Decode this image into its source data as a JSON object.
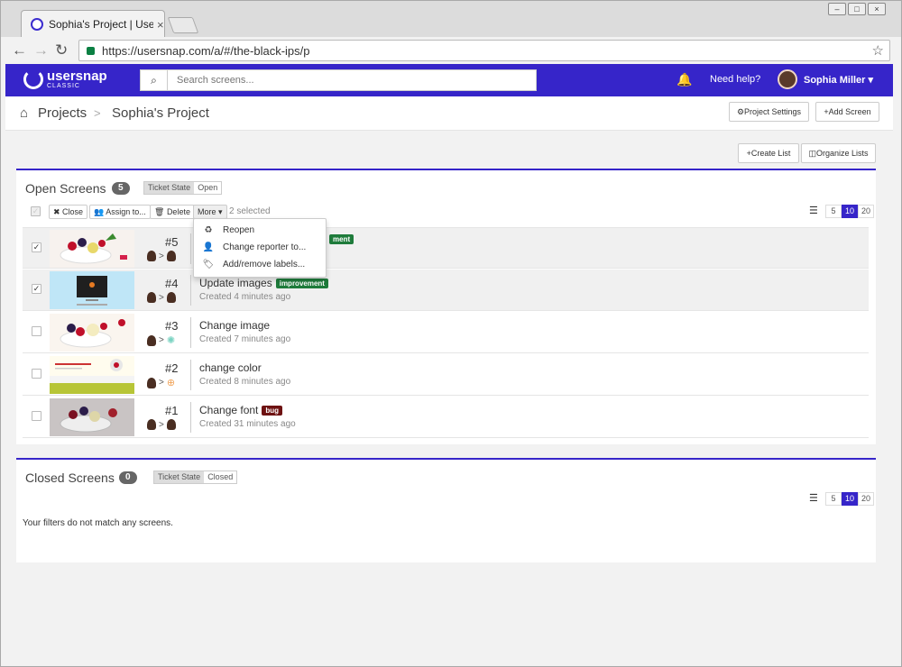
{
  "browser": {
    "tab_title": "Sophia's Project | Usersnap",
    "url": "https://usersnap.com/a/#/the-black-ips/p"
  },
  "topbar": {
    "logo": "usersnap",
    "logo_sub": "CLASSIC",
    "search_placeholder": "Search screens...",
    "help": "Need help?",
    "user": "Sophia Miller"
  },
  "breadcrumb": {
    "projects": "Projects",
    "separator": ">",
    "project": "Sophia's Project"
  },
  "buttons": {
    "project_settings": "Project Settings",
    "add_screen": "Add Screen",
    "create_list": "Create List",
    "organize_lists": "Organize Lists"
  },
  "open_panel": {
    "title": "Open Screens",
    "count": "5",
    "filter_key": "Ticket State",
    "filter_value": "Open",
    "actions": {
      "close": "Close",
      "assign": "Assign to...",
      "delete": "Delete",
      "more": "More",
      "selected": "2 selected"
    },
    "pager": [
      "5",
      "10",
      "20"
    ],
    "dropdown": [
      "Reopen",
      "Change reporter to...",
      "Add/remove labels..."
    ],
    "rows": [
      {
        "num": "#5",
        "title": "",
        "label": "improvement",
        "created": ""
      },
      {
        "num": "#4",
        "title": "Update images",
        "label": "improvement",
        "created": "Created 4 minutes ago"
      },
      {
        "num": "#3",
        "title": "Change image",
        "label": "",
        "created": "Created 7 minutes ago"
      },
      {
        "num": "#2",
        "title": "change color",
        "label": "",
        "created": "Created 8 minutes ago"
      },
      {
        "num": "#1",
        "title": "Change font",
        "label": "bug",
        "created": "Created 31 minutes ago"
      }
    ],
    "label_visible_5": "ment"
  },
  "closed_panel": {
    "title": "Closed Screens",
    "count": "0",
    "filter_key": "Ticket State",
    "filter_value": "Closed",
    "pager": [
      "5",
      "10",
      "20"
    ],
    "empty": "Your filters do not match any screens."
  },
  "colors": {
    "brand": "#3625c9",
    "improvement": "#1e7b3b",
    "bug": "#6e1212"
  }
}
